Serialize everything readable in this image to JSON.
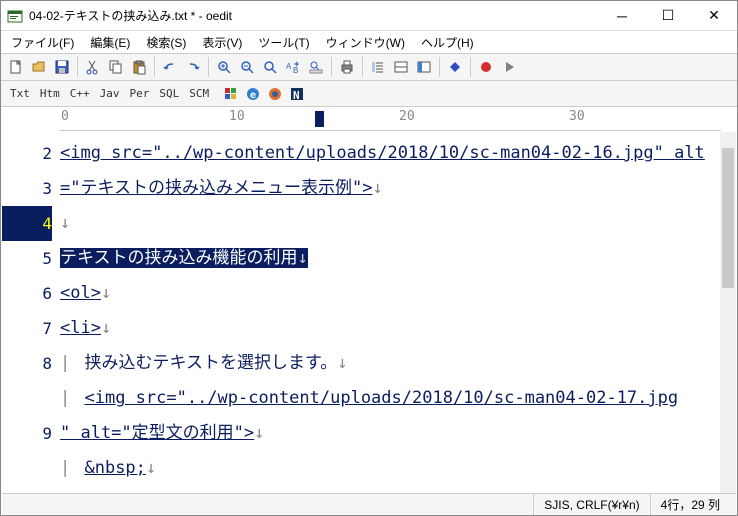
{
  "window": {
    "title": "04-02-テキストの挟み込み.txt * - oedit"
  },
  "menu": {
    "file": "ファイル(F)",
    "edit": "編集(E)",
    "search": "検索(S)",
    "view": "表示(V)",
    "tool": "ツール(T)",
    "window": "ウィンドウ(W)",
    "help": "ヘルプ(H)"
  },
  "langs": [
    "Txt",
    "Htm",
    "C++",
    "Jav",
    "Per",
    "SQL",
    "SCM"
  ],
  "ruler": {
    "t0": "0",
    "t10": "10",
    "t20": "20",
    "t30": "30"
  },
  "gutter": [
    "2",
    "3",
    "4",
    "5",
    "6",
    "7",
    "8",
    "",
    "9"
  ],
  "lines": {
    "l2a": "<img src=\"../wp-content/uploads/2018/10/sc-man04-02-16.jpg\" alt",
    "l2b": "=\"テキストの挟み込みメニュー表示例\">",
    "l4sel": "テキストの挟み込み機能の利用",
    "l5": "<ol>",
    "l6": "<li>",
    "l7": "挟み込むテキストを選択します。",
    "l8a": "<img src=\"../wp-content/uploads/2018/10/sc-man04-02-17.jpg",
    "l8b": "\" alt=\"定型文の利用\">",
    "l9": "&nbsp;"
  },
  "status": {
    "encoding": "SJIS, CRLF(¥r¥n)",
    "pos": "4行，29 列"
  }
}
